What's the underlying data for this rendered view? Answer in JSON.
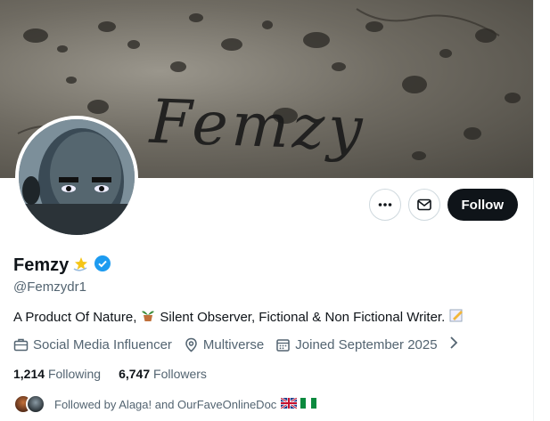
{
  "profile": {
    "banner_text": "Femzy",
    "display_name": "Femzy",
    "handle": "@Femzydr1",
    "bio": "A Product Of Nature,",
    "bio_mid": "Silent Observer, Fictional & Non Fictional Writer.",
    "category": "Social Media Influencer",
    "location": "Multiverse",
    "joined": "Joined September 2025",
    "following_count": "1,214",
    "following_label": "Following",
    "followers_count": "6,747",
    "followers_label": "Followers",
    "followed_by": "Followed by Alaga! and OurFaveOnlineDoc"
  },
  "actions": {
    "follow_label": "Follow"
  },
  "icons": [
    "more-icon",
    "message-icon",
    "verified-badge-icon",
    "briefcase-icon",
    "location-pin-icon",
    "calendar-icon",
    "chevron-right-icon"
  ],
  "colors": {
    "verified": "#1d9bf0",
    "follow_bg": "#0f1419",
    "muted": "#536471"
  }
}
